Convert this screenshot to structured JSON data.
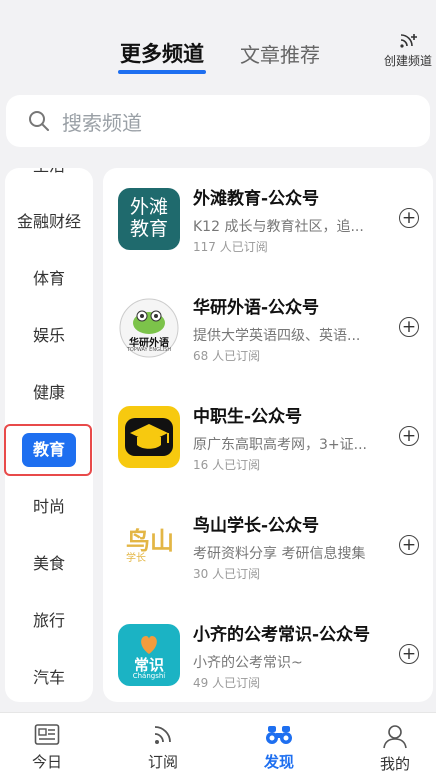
{
  "header": {
    "tab_active": "更多频道",
    "tab_other": "文章推荐",
    "create_channel_label": "创建频道"
  },
  "search": {
    "placeholder": "搜索频道"
  },
  "categories": {
    "partial_top": "生活",
    "items": [
      "金融财经",
      "体育",
      "娱乐",
      "健康",
      "教育",
      "时尚",
      "美食",
      "旅行",
      "汽车"
    ],
    "active": "教育"
  },
  "channels": [
    {
      "title": "外滩教育-公众号",
      "desc": "K12 成长与教育社区，追...",
      "subs": "117 人已订阅",
      "logo_text": [
        "外滩",
        "教育"
      ]
    },
    {
      "title": "华研外语-公众号",
      "desc": "提供大学英语四级、英语...",
      "subs": "68 人已订阅",
      "logo_text": [
        "华研外语",
        "TOPWAY ENGLISH"
      ]
    },
    {
      "title": "中职生-公众号",
      "desc": "原广东高职高考网，3+证...",
      "subs": "16 人已订阅"
    },
    {
      "title": "鸟山学长-公众号",
      "desc": "考研资料分享 考研信息搜集",
      "subs": "30 人已订阅",
      "logo_text": [
        "鸟山",
        "学长"
      ]
    },
    {
      "title": "小齐的公考常识-公众号",
      "desc": "小齐的公考常识~",
      "subs": "49 人已订阅",
      "logo_text": [
        "常识",
        "Chángshí"
      ]
    }
  ],
  "bottom_nav": [
    {
      "label": "今日",
      "icon": "newspaper-icon"
    },
    {
      "label": "订阅",
      "icon": "rss-icon"
    },
    {
      "label": "发现",
      "icon": "binoculars-icon",
      "active": true
    },
    {
      "label": "我的",
      "icon": "person-icon"
    }
  ],
  "colors": {
    "accent": "#1e6ff0",
    "highlight_border": "#e84a4a"
  }
}
